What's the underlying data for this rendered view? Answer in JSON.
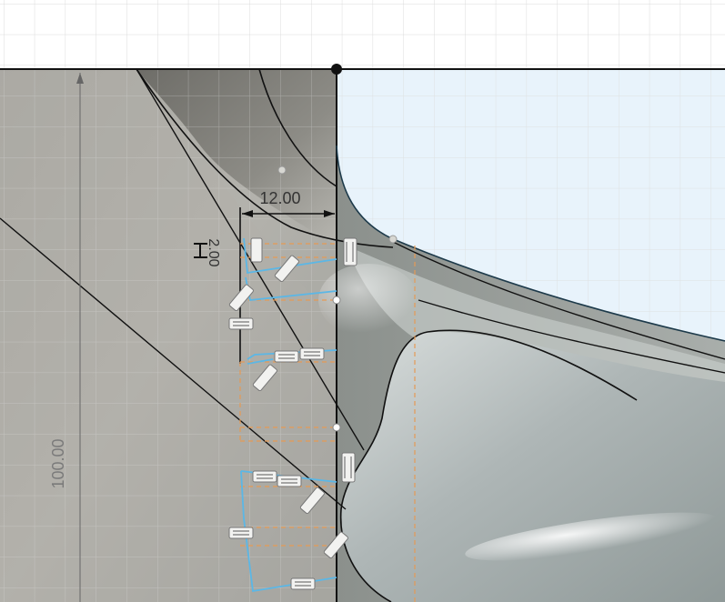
{
  "sketch": {
    "dimensions": {
      "width_label": "12.00",
      "height_label": "2.00",
      "overall_label": "100.00"
    }
  },
  "colors": {
    "canvas_background": "#ffffff",
    "grid_line": "#dcdcdc",
    "sketch_plane_fill": "#e8f3fb",
    "body_surface": "#a9aaa4",
    "sketch_line": "#111111",
    "constraint_blue": "#5bb7e6",
    "construction_orange": "#e59a55",
    "dimension_text": "#333333"
  },
  "icons": {
    "constraint_glyph": "parallel-constraint-icon",
    "origin_point": "sketch-point-icon"
  }
}
